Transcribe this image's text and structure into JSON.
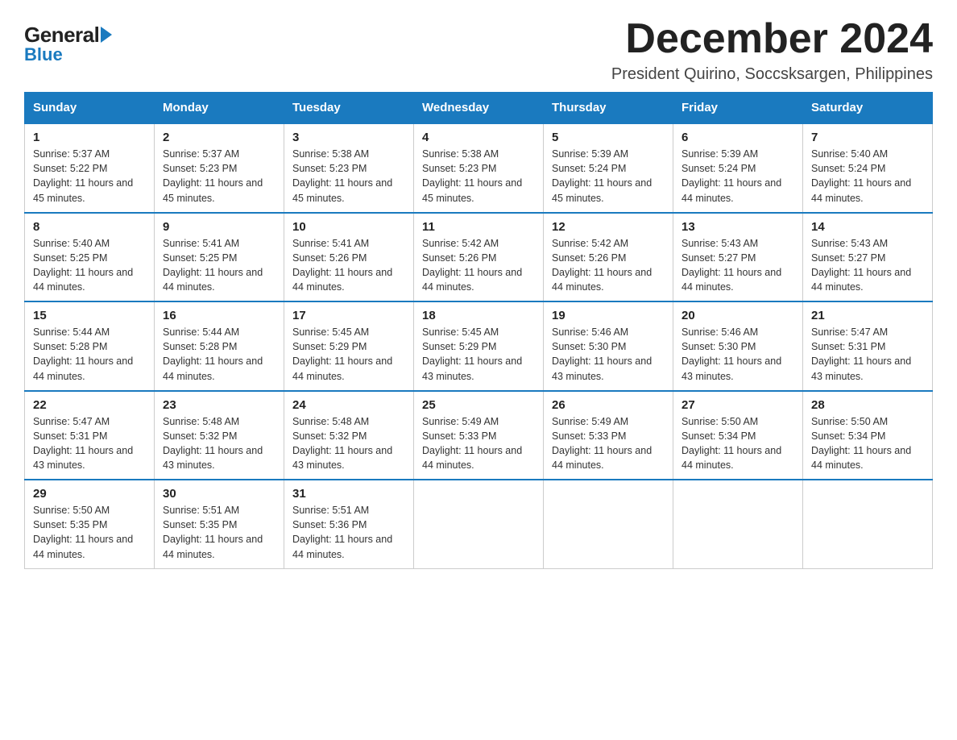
{
  "logo": {
    "general": "General",
    "blue": "Blue"
  },
  "title": {
    "month_year": "December 2024",
    "location": "President Quirino, Soccsksargen, Philippines"
  },
  "days_of_week": [
    "Sunday",
    "Monday",
    "Tuesday",
    "Wednesday",
    "Thursday",
    "Friday",
    "Saturday"
  ],
  "weeks": [
    [
      {
        "day": "1",
        "sunrise": "5:37 AM",
        "sunset": "5:22 PM",
        "daylight": "11 hours and 45 minutes."
      },
      {
        "day": "2",
        "sunrise": "5:37 AM",
        "sunset": "5:23 PM",
        "daylight": "11 hours and 45 minutes."
      },
      {
        "day": "3",
        "sunrise": "5:38 AM",
        "sunset": "5:23 PM",
        "daylight": "11 hours and 45 minutes."
      },
      {
        "day": "4",
        "sunrise": "5:38 AM",
        "sunset": "5:23 PM",
        "daylight": "11 hours and 45 minutes."
      },
      {
        "day": "5",
        "sunrise": "5:39 AM",
        "sunset": "5:24 PM",
        "daylight": "11 hours and 45 minutes."
      },
      {
        "day": "6",
        "sunrise": "5:39 AM",
        "sunset": "5:24 PM",
        "daylight": "11 hours and 44 minutes."
      },
      {
        "day": "7",
        "sunrise": "5:40 AM",
        "sunset": "5:24 PM",
        "daylight": "11 hours and 44 minutes."
      }
    ],
    [
      {
        "day": "8",
        "sunrise": "5:40 AM",
        "sunset": "5:25 PM",
        "daylight": "11 hours and 44 minutes."
      },
      {
        "day": "9",
        "sunrise": "5:41 AM",
        "sunset": "5:25 PM",
        "daylight": "11 hours and 44 minutes."
      },
      {
        "day": "10",
        "sunrise": "5:41 AM",
        "sunset": "5:26 PM",
        "daylight": "11 hours and 44 minutes."
      },
      {
        "day": "11",
        "sunrise": "5:42 AM",
        "sunset": "5:26 PM",
        "daylight": "11 hours and 44 minutes."
      },
      {
        "day": "12",
        "sunrise": "5:42 AM",
        "sunset": "5:26 PM",
        "daylight": "11 hours and 44 minutes."
      },
      {
        "day": "13",
        "sunrise": "5:43 AM",
        "sunset": "5:27 PM",
        "daylight": "11 hours and 44 minutes."
      },
      {
        "day": "14",
        "sunrise": "5:43 AM",
        "sunset": "5:27 PM",
        "daylight": "11 hours and 44 minutes."
      }
    ],
    [
      {
        "day": "15",
        "sunrise": "5:44 AM",
        "sunset": "5:28 PM",
        "daylight": "11 hours and 44 minutes."
      },
      {
        "day": "16",
        "sunrise": "5:44 AM",
        "sunset": "5:28 PM",
        "daylight": "11 hours and 44 minutes."
      },
      {
        "day": "17",
        "sunrise": "5:45 AM",
        "sunset": "5:29 PM",
        "daylight": "11 hours and 44 minutes."
      },
      {
        "day": "18",
        "sunrise": "5:45 AM",
        "sunset": "5:29 PM",
        "daylight": "11 hours and 43 minutes."
      },
      {
        "day": "19",
        "sunrise": "5:46 AM",
        "sunset": "5:30 PM",
        "daylight": "11 hours and 43 minutes."
      },
      {
        "day": "20",
        "sunrise": "5:46 AM",
        "sunset": "5:30 PM",
        "daylight": "11 hours and 43 minutes."
      },
      {
        "day": "21",
        "sunrise": "5:47 AM",
        "sunset": "5:31 PM",
        "daylight": "11 hours and 43 minutes."
      }
    ],
    [
      {
        "day": "22",
        "sunrise": "5:47 AM",
        "sunset": "5:31 PM",
        "daylight": "11 hours and 43 minutes."
      },
      {
        "day": "23",
        "sunrise": "5:48 AM",
        "sunset": "5:32 PM",
        "daylight": "11 hours and 43 minutes."
      },
      {
        "day": "24",
        "sunrise": "5:48 AM",
        "sunset": "5:32 PM",
        "daylight": "11 hours and 43 minutes."
      },
      {
        "day": "25",
        "sunrise": "5:49 AM",
        "sunset": "5:33 PM",
        "daylight": "11 hours and 44 minutes."
      },
      {
        "day": "26",
        "sunrise": "5:49 AM",
        "sunset": "5:33 PM",
        "daylight": "11 hours and 44 minutes."
      },
      {
        "day": "27",
        "sunrise": "5:50 AM",
        "sunset": "5:34 PM",
        "daylight": "11 hours and 44 minutes."
      },
      {
        "day": "28",
        "sunrise": "5:50 AM",
        "sunset": "5:34 PM",
        "daylight": "11 hours and 44 minutes."
      }
    ],
    [
      {
        "day": "29",
        "sunrise": "5:50 AM",
        "sunset": "5:35 PM",
        "daylight": "11 hours and 44 minutes."
      },
      {
        "day": "30",
        "sunrise": "5:51 AM",
        "sunset": "5:35 PM",
        "daylight": "11 hours and 44 minutes."
      },
      {
        "day": "31",
        "sunrise": "5:51 AM",
        "sunset": "5:36 PM",
        "daylight": "11 hours and 44 minutes."
      },
      null,
      null,
      null,
      null
    ]
  ]
}
